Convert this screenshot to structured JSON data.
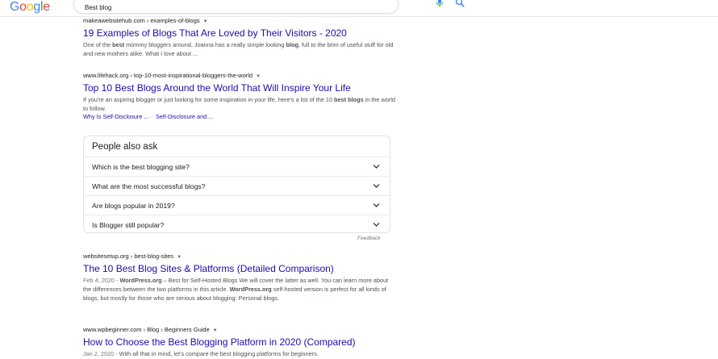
{
  "header": {
    "logo_letters": [
      {
        "ch": "G",
        "color": "#4285F4"
      },
      {
        "ch": "o",
        "color": "#EA4335"
      },
      {
        "ch": "o",
        "color": "#FBBC05"
      },
      {
        "ch": "g",
        "color": "#4285F4"
      },
      {
        "ch": "l",
        "color": "#34A853"
      },
      {
        "ch": "e",
        "color": "#EA4335"
      }
    ],
    "search_value": "Best blog",
    "icons": {
      "mic": "mic-icon",
      "search": "search-icon"
    }
  },
  "results": [
    {
      "cite": "makeawebsitehub.com › examples-of-blogs",
      "title": "19 Examples of Blogs That Are Loved by Their Visitors - 2020",
      "snippet_html": "One of the <b>best</b> mommy bloggers around, Joanna has a really simple looking <b>blog</b>, full to the brim of useful stuff for old and new mothers alike. What I love about ..."
    },
    {
      "cite": "www.lifehack.org › top-10-most-inspirational-bloggers-the-world",
      "title": "Top 10 Best Blogs Around the World That Will Inspire Your Life",
      "snippet_html": "If you're an aspiring blogger or just looking for some inspiration in your life, here's a list of the 10 <b>best blogs</b> in the world to follow.",
      "sitelinks": [
        "Why Is Self-Disclosure ...",
        "Self-Disclosure and ..."
      ]
    },
    {
      "cite": "websitesetup.org › best-blog-sites",
      "title": "The 10 Best Blog Sites & Platforms (Detailed Comparison)",
      "date": "Feb 4, 2020",
      "snippet_html": "<b>WordPress.org</b> – Best for Self-Hosted Blogs We will cover the latter as well. You can learn more about the differences between the two platforms in this article. <b>WordPress.org</b> self-hosted version is perfect for all kinds of blogs, but mostly for those who are serious about blogging: Personal blogs."
    },
    {
      "cite": "www.wpbeginner.com › Blog › Beginners Guide",
      "title": "How to Choose the Best Blogging Platform in 2020 (Compared)",
      "date": "Jan 2, 2020",
      "snippet_html": "With all that in mind, let's compare the best blogging platforms for beginners."
    }
  ],
  "people_also_ask": {
    "title": "People also ask",
    "questions": [
      "Which is the best blogging site?",
      "What are the most successful blogs?",
      "Are blogs popular in 2019?",
      "Is Blogger still popular?"
    ]
  },
  "feedback_label": "Feedback"
}
